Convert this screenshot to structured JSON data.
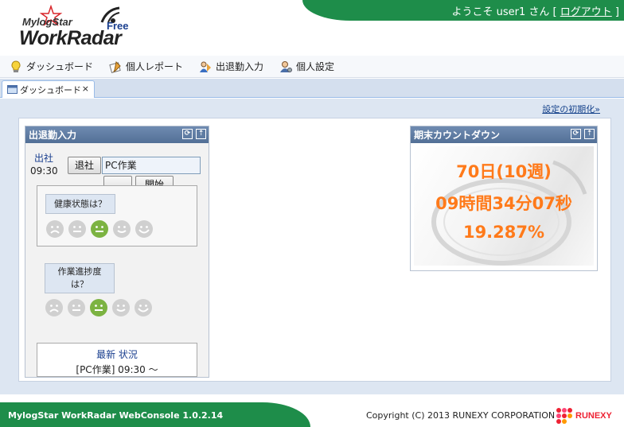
{
  "header": {
    "greeting_prefix": "ようこそ user1 さん [",
    "logout_label": "ログアウト",
    "greeting_suffix": "]",
    "logo_small": "MylogStar",
    "logo_big": "WorkRadar",
    "logo_free": "Free"
  },
  "menu": {
    "items": [
      {
        "label": "ダッシュボード",
        "icon": "lightbulb-icon"
      },
      {
        "label": "個人レポート",
        "icon": "report-icon"
      },
      {
        "label": "出退勤入力",
        "icon": "attendance-icon"
      },
      {
        "label": "個人設定",
        "icon": "person-settings-icon"
      }
    ]
  },
  "tab": {
    "label": "ダッシュボード",
    "close": "×"
  },
  "main": {
    "reset_label": "設定の初期化»"
  },
  "attendance": {
    "title": "出退勤入力",
    "in_label": "出社",
    "in_time": "09:30",
    "leave_button": "退社",
    "task_value": "PC作業",
    "more_button": "...",
    "start_button": "開始",
    "health_question": "健康状態は？",
    "progress_question_line1": "作業進捗度",
    "progress_question_line2": "は？",
    "status_title": "最新 状況",
    "status_value": "[PC作業] 09:30 ～",
    "selected_health_level": 3,
    "selected_progress_level": 3
  },
  "countdown": {
    "title": "期末カウントダウン",
    "days": "70日(10週)",
    "time": "09時間34分07秒",
    "percent": "19.287%"
  },
  "footer": {
    "product": "MylogStar WorkRadar WebConsole 1.0.2.14",
    "copyright": "Copyright (C) 2013 RUNEXY CORPORATION",
    "company_logo": "RUNEXY"
  },
  "colors": {
    "brand_green": "#1e8d4a",
    "panel_header": "#5f7ca3",
    "countdown_orange": "#ff7a1a",
    "link_blue": "#15428b"
  }
}
